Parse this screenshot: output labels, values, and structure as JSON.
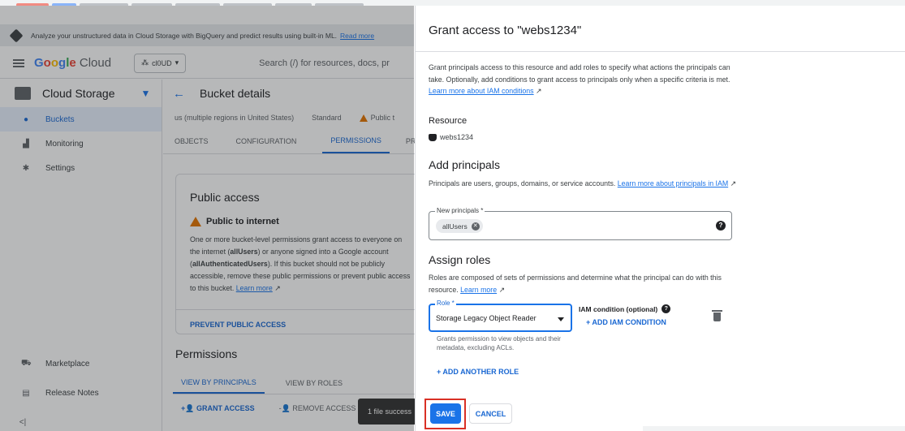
{
  "banner": {
    "text": "Analyze your unstructured data in Cloud Storage with BigQuery and predict results using built-in ML.",
    "link": "Read more"
  },
  "header": {
    "logo": "Google Cloud",
    "project": "cl0UD",
    "search_placeholder": "Search (/) for resources, docs, pr"
  },
  "sidebar": {
    "title": "Cloud Storage",
    "items": [
      {
        "label": "Buckets",
        "icon": "bucket-icon"
      },
      {
        "label": "Monitoring",
        "icon": "chart-icon"
      },
      {
        "label": "Settings",
        "icon": "gear-icon"
      }
    ],
    "bottom_items": [
      {
        "label": "Marketplace",
        "icon": "cart-icon"
      },
      {
        "label": "Release Notes",
        "icon": "notes-icon"
      }
    ],
    "collapse": "<|"
  },
  "main": {
    "title": "Bucket details",
    "meta_location": "us (multiple regions in United States)",
    "meta_class": "Standard",
    "meta_public": "Public t",
    "tabs": [
      "OBJECTS",
      "CONFIGURATION",
      "PERMISSIONS",
      "PRO"
    ],
    "public_access": {
      "title": "Public access",
      "warning": "Public to internet",
      "body_1": "One or more bucket-level permissions grant access to everyone on the internet (",
      "body_b1": "allUsers",
      "body_2": ") or anyone signed into a Google account (",
      "body_b2": "allAuthenticatedUsers",
      "body_3": "). If this bucket should not be publicly accessible, remove these public permissions or prevent public access to this bucket.",
      "learn_more": "Learn more",
      "prevent_button": "PREVENT PUBLIC ACCESS"
    },
    "permissions_title": "Permissions",
    "perm_tabs": [
      "VIEW BY PRINCIPALS",
      "VIEW BY ROLES"
    ],
    "grant_access": "GRANT ACCESS",
    "remove_access": "REMOVE ACCESS",
    "toast": "1 file success"
  },
  "dialog": {
    "title": "Grant access to \"webs1234\"",
    "intro": "Grant principals access to this resource and add roles to specify what actions the principals can take. Optionally, add conditions to grant access to principals only when a specific criteria is met.",
    "intro_link": "Learn more about IAM conditions",
    "resource_label": "Resource",
    "resource_name": "webs1234",
    "add_principals_title": "Add principals",
    "principals_help": "Principals are users, groups, domains, or service accounts.",
    "principals_link": "Learn more about principals in IAM",
    "new_principals_label": "New principals *",
    "principal_chip": "allUsers",
    "assign_roles_title": "Assign roles",
    "roles_help": "Roles are composed of sets of permissions and determine what the principal can do with this resource.",
    "roles_link": "Learn more",
    "role_label": "Role *",
    "role_value": "Storage Legacy Object Reader",
    "role_description": "Grants permission to view objects and their metadata, excluding ACLs.",
    "iam_condition_label": "IAM condition (optional)",
    "add_condition": "+ ADD IAM CONDITION",
    "add_role": "+ ADD ANOTHER ROLE",
    "save": "SAVE",
    "cancel": "CANCEL"
  },
  "colors": {
    "accent": "#1a73e8",
    "warning": "#e37400",
    "highlight_box": "#d93025"
  }
}
